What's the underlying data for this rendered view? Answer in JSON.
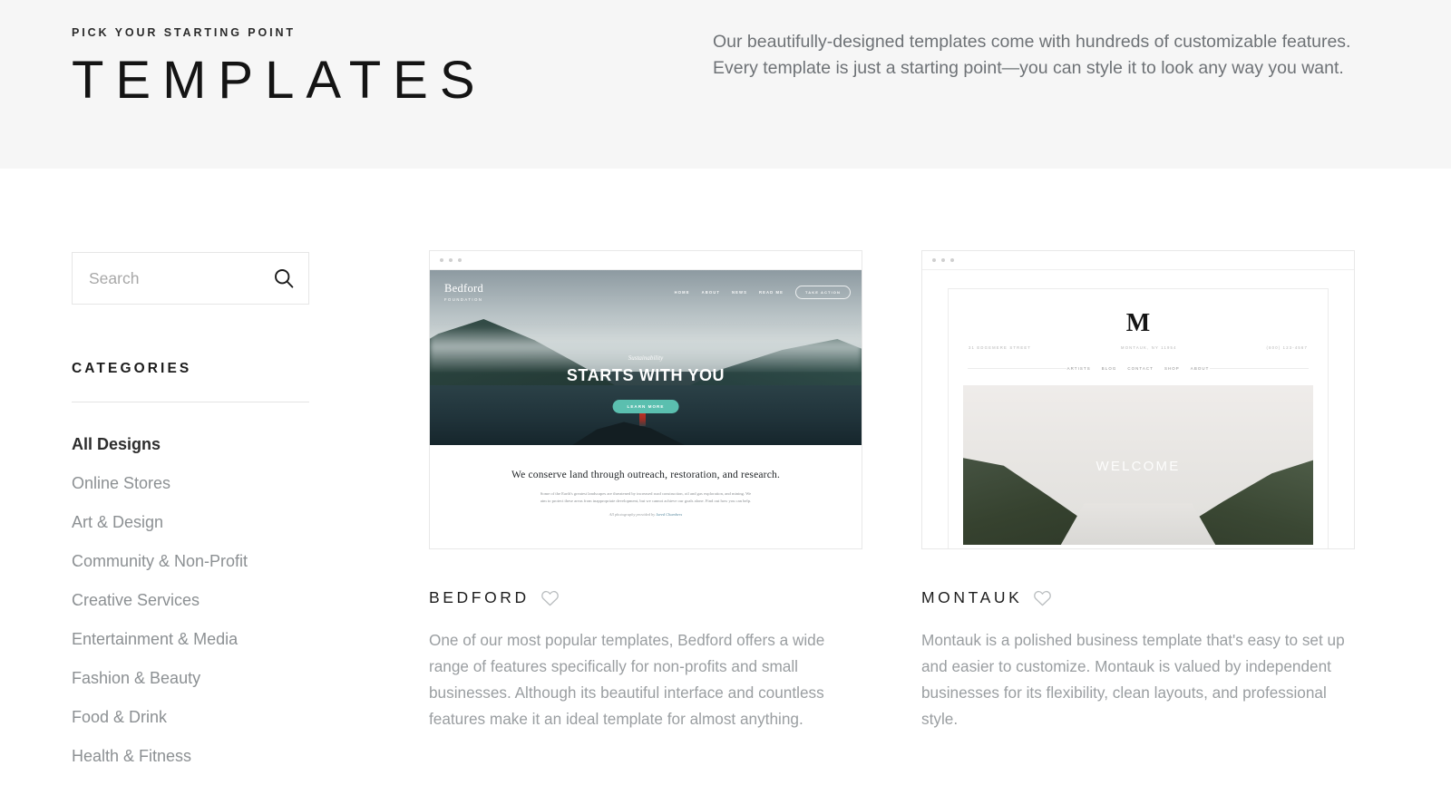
{
  "header": {
    "eyebrow": "PICK YOUR STARTING POINT",
    "title": "TEMPLATES",
    "description": "Our beautifully-designed templates come with hundreds of customizable features. Every template is just a starting point—you can style it to look any way you want."
  },
  "sidebar": {
    "search": {
      "placeholder": "Search",
      "value": "",
      "icon": "search-icon"
    },
    "categories_heading": "CATEGORIES",
    "categories": [
      {
        "label": "All Designs",
        "active": true
      },
      {
        "label": "Online Stores",
        "active": false
      },
      {
        "label": "Art & Design",
        "active": false
      },
      {
        "label": "Community & Non-Profit",
        "active": false
      },
      {
        "label": "Creative Services",
        "active": false
      },
      {
        "label": "Entertainment & Media",
        "active": false
      },
      {
        "label": "Fashion & Beauty",
        "active": false
      },
      {
        "label": "Food & Drink",
        "active": false
      },
      {
        "label": "Health & Fitness",
        "active": false
      }
    ]
  },
  "templates": [
    {
      "name": "BEDFORD",
      "favorite_icon": "heart-outline-icon",
      "description": "One of our most popular templates, Bedford offers a wide range of features specifically for non-profits and small businesses. Although its beautiful interface and countless features make it an ideal template for almost anything.",
      "preview": {
        "logo": "Bedford",
        "logo_sub": "FOUNDATION",
        "nav": [
          "HOME",
          "ABOUT",
          "NEWS",
          "READ ME"
        ],
        "nav_cta": "TAKE ACTION",
        "hero_eyebrow": "Sustainability",
        "hero_headline": "STARTS WITH YOU",
        "hero_button": "LEARN MORE",
        "body_headline": "We conserve land through outreach, restoration, and research.",
        "body_paragraph": "Some of the Earth's greatest landscapes are threatened by increased road construction, oil and gas exploration, and mining. We aim to protect these areas from inappropriate development, but we cannot achieve our goals alone. Find out how you can help.",
        "body_credit_prefix": "All photography provided by ",
        "body_credit_name": "Jared Chambers",
        "accent_color": "#5bbfaf"
      }
    },
    {
      "name": "MONTAUK",
      "favorite_icon": "heart-outline-icon",
      "description": "Montauk is a polished business template that's easy to set up and easier to customize. Montauk is valued by independent businesses for its flexibility, clean layouts, and professional style.",
      "preview": {
        "logo": "M",
        "address_left": "31 EDGEMERE STREET",
        "address_center": "MONTAUK, NY 11954",
        "address_right": "(800) 123-4567",
        "nav": [
          "ARTISTS",
          "BLOG",
          "CONTACT",
          "SHOP",
          "ABOUT"
        ],
        "hero_headline": "WELCOME"
      }
    }
  ],
  "colors": {
    "header_band": "#f6f6f6",
    "page_background": "#ffffff",
    "muted_text": "#9a9ea1",
    "title_text": "#1d1d1d",
    "border": "#e6e6e6"
  }
}
